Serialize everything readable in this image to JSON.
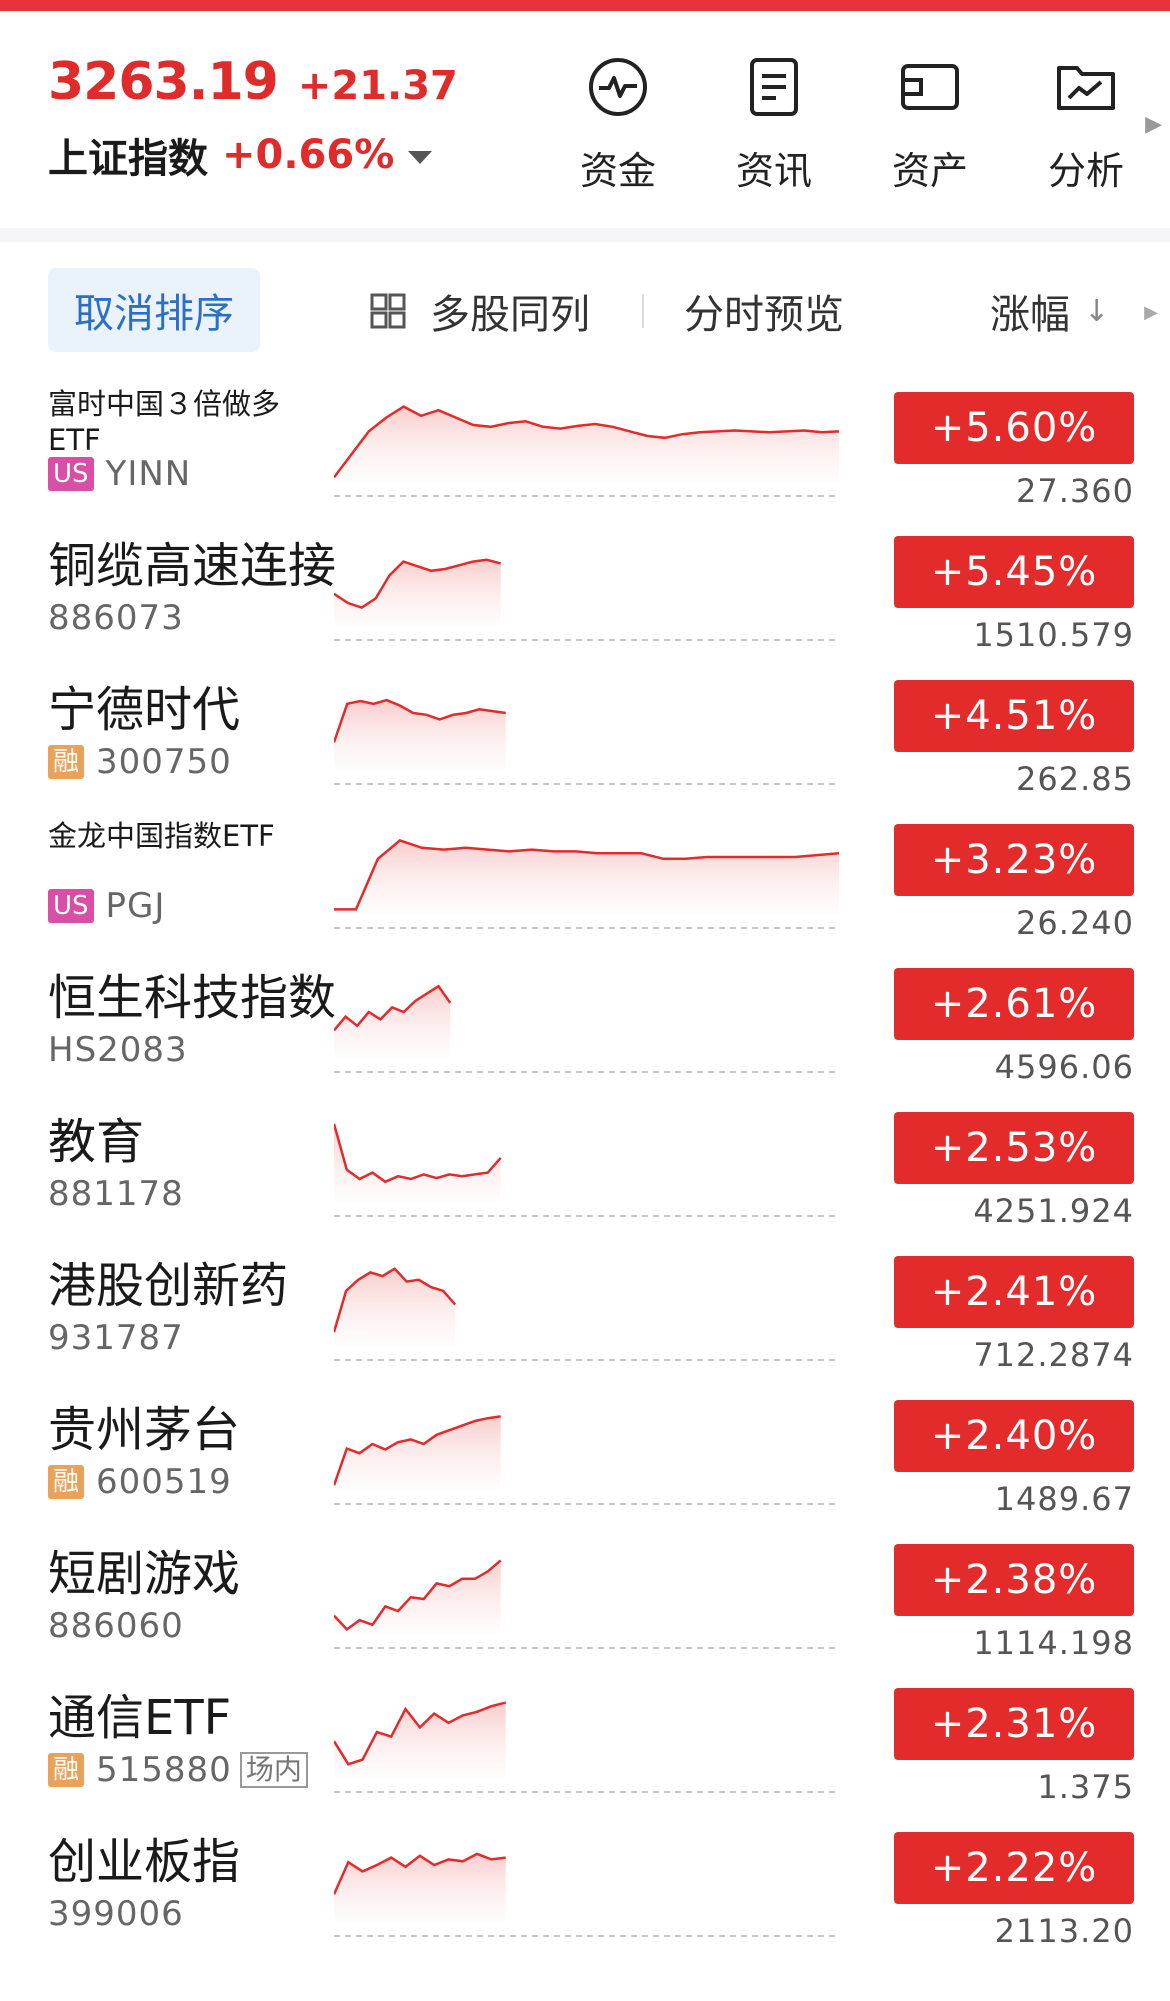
{
  "header": {
    "index_value": "3263.19",
    "index_change": "+21.37",
    "index_name": "上证指数",
    "index_pct": "+0.66%"
  },
  "quick_nav": [
    {
      "label": "资金",
      "icon": "fund-flow-icon"
    },
    {
      "label": "资讯",
      "icon": "news-icon"
    },
    {
      "label": "资产",
      "icon": "wallet-icon"
    },
    {
      "label": "分析",
      "icon": "analysis-chart-icon"
    }
  ],
  "toolbar": {
    "cancel_sort": "取消排序",
    "multi_stock": "多股同列",
    "preview": "分时预览",
    "sort_column": "涨幅"
  },
  "colors": {
    "up": "#e32b2b",
    "accent": "#2d6fc7",
    "us_badge": "#d94fa8",
    "margin_badge": "#e8a25a"
  },
  "stocks": [
    {
      "name": "富时中国３倍做多ETF",
      "code": "YINN",
      "badge": "US",
      "pct": "+5.60%",
      "price": "27.360",
      "progress": 1.0,
      "trend": [
        0.05,
        0.3,
        0.55,
        0.7,
        0.82,
        0.72,
        0.78,
        0.7,
        0.62,
        0.6,
        0.64,
        0.66,
        0.6,
        0.58,
        0.61,
        0.63,
        0.6,
        0.55,
        0.5,
        0.48,
        0.52,
        0.54,
        0.55,
        0.56,
        0.55,
        0.54,
        0.55,
        0.56,
        0.54,
        0.55
      ]
    },
    {
      "name": "铜缆高速连接",
      "code": "886073",
      "pct": "+5.45%",
      "price": "1510.579",
      "progress": 0.33,
      "trend": [
        0.35,
        0.25,
        0.2,
        0.3,
        0.55,
        0.7,
        0.65,
        0.6,
        0.62,
        0.66,
        0.7,
        0.72,
        0.68
      ]
    },
    {
      "name": "宁德时代",
      "code": "300750",
      "badge": "融",
      "pct": "+4.51%",
      "price": "262.85",
      "progress": 0.34,
      "trend": [
        0.3,
        0.72,
        0.75,
        0.72,
        0.76,
        0.7,
        0.62,
        0.6,
        0.55,
        0.6,
        0.62,
        0.66,
        0.64,
        0.62
      ]
    },
    {
      "name": "金龙中国指数ETF",
      "code": "PGJ",
      "badge": "US",
      "pct": "+3.23%",
      "price": "26.240",
      "progress": 1.0,
      "trend": [
        0.05,
        0.05,
        0.6,
        0.8,
        0.72,
        0.7,
        0.72,
        0.7,
        0.68,
        0.7,
        0.68,
        0.68,
        0.66,
        0.66,
        0.66,
        0.6,
        0.6,
        0.62,
        0.62,
        0.62,
        0.62,
        0.62,
        0.64,
        0.66
      ]
    },
    {
      "name": "恒生科技指数",
      "code": "HS2083",
      "pct": "+2.61%",
      "price": "4596.06",
      "progress": 0.23,
      "trend": [
        0.3,
        0.45,
        0.35,
        0.5,
        0.42,
        0.55,
        0.5,
        0.62,
        0.7,
        0.78,
        0.6
      ]
    },
    {
      "name": "教育",
      "code": "881178",
      "pct": "+2.53%",
      "price": "4251.924",
      "progress": 0.33,
      "trend": [
        0.85,
        0.35,
        0.25,
        0.32,
        0.22,
        0.28,
        0.25,
        0.3,
        0.26,
        0.3,
        0.28,
        0.3,
        0.32,
        0.48
      ]
    },
    {
      "name": "港股创新药",
      "code": "931787",
      "pct": "+2.41%",
      "price": "712.2874",
      "progress": 0.24,
      "trend": [
        0.15,
        0.6,
        0.72,
        0.8,
        0.76,
        0.84,
        0.7,
        0.72,
        0.64,
        0.6,
        0.45
      ]
    },
    {
      "name": "贵州茅台",
      "code": "600519",
      "badge": "融",
      "pct": "+2.40%",
      "price": "1489.67",
      "progress": 0.33,
      "trend": [
        0.05,
        0.45,
        0.4,
        0.5,
        0.44,
        0.52,
        0.55,
        0.5,
        0.6,
        0.65,
        0.7,
        0.75,
        0.78,
        0.8
      ]
    },
    {
      "name": "短剧游戏",
      "code": "886060",
      "pct": "+2.38%",
      "price": "1114.198",
      "progress": 0.33,
      "trend": [
        0.2,
        0.05,
        0.15,
        0.1,
        0.3,
        0.25,
        0.4,
        0.38,
        0.55,
        0.52,
        0.6,
        0.6,
        0.68,
        0.8
      ]
    },
    {
      "name": "通信ETF",
      "code": "515880",
      "badge": "融",
      "tag": "场内",
      "pct": "+2.31%",
      "price": "1.375",
      "progress": 0.34,
      "trend": [
        0.4,
        0.15,
        0.2,
        0.5,
        0.45,
        0.75,
        0.55,
        0.7,
        0.6,
        0.68,
        0.72,
        0.78,
        0.82
      ]
    },
    {
      "name": "创业板指",
      "code": "399006",
      "pct": "+2.22%",
      "price": "2113.20",
      "progress": 0.34,
      "trend": [
        0.3,
        0.65,
        0.55,
        0.62,
        0.7,
        0.6,
        0.72,
        0.62,
        0.68,
        0.66,
        0.74,
        0.68,
        0.7
      ]
    }
  ]
}
